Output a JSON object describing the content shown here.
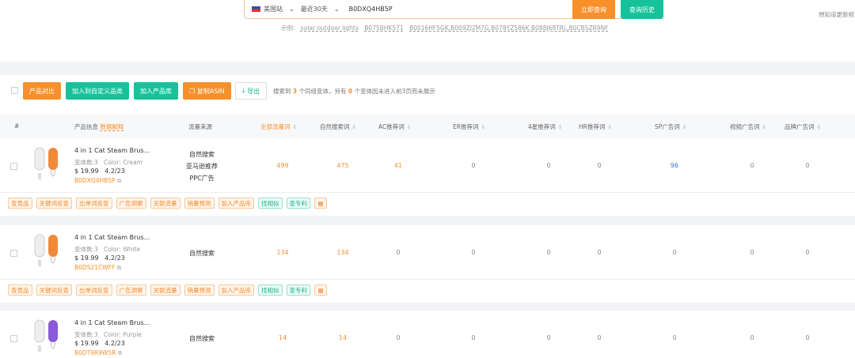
{
  "search": {
    "site": "美国站",
    "period": "最近30天",
    "query": "B0DXQ4HB5P",
    "search_button": "立即查询",
    "history_button": "查询历史"
  },
  "examples": {
    "label": "示例:",
    "items": [
      "solar outdoor lights",
      "B075BHK571",
      "B0016HF5GK,B009ZJ2M7G,B078YZ586K,B088J68TRL,B0CBSZR9NF"
    ]
  },
  "top_hint": "想知道更新频",
  "toolbar": {
    "compare": "产品对比",
    "add_custom": "加入到自定义品类",
    "add_library": "加入产品库",
    "copy_asin": "复制ASIN",
    "export": "导出",
    "summary_pre": "搜索到",
    "count1": "3",
    "summary_mid": "个同组变体，另有",
    "count2": "0",
    "summary_post": "个变体因未进入前3页而未展示"
  },
  "columns": {
    "index": "#",
    "product": "产品信息",
    "explain": "数据解释",
    "source": "流量来源",
    "all": "全部流量词",
    "organic": "自然搜索词",
    "ac": "AC推荐词",
    "er": "ER推荐词",
    "star4": "4星推荐词",
    "hr": "HR推荐词",
    "sp": "SP广告词",
    "video": "视频广告词",
    "brand": "品牌广告词"
  },
  "actions": [
    "查竞品",
    "关键词反查",
    "出单词反查",
    "广告洞察",
    "关联流量",
    "销量预测",
    "加入产品库",
    "找相似",
    "查专利"
  ],
  "rows": [
    {
      "title": "4 in 1 Cat Steam Brus...",
      "variants": "变体数:3",
      "color": "Color: Cream",
      "price": "$ 19.99",
      "rating": "4.2/23",
      "asin": "B0DXQ4HB5P",
      "sources": [
        "自然搜索",
        "亚马逊推荐",
        "PPC广告"
      ],
      "all": "499",
      "organic": "475",
      "ac": "41",
      "er": "0",
      "star4": "0",
      "hr": "0",
      "sp": "96",
      "video": "0",
      "brand": "0",
      "accent": "#f08a3a"
    },
    {
      "title": "4 in 1 Cat Steam Brus...",
      "variants": "变体数:3",
      "color": "Color: White",
      "price": "$ 19.99",
      "rating": "4.2/23",
      "asin": "B0DS21CWFF",
      "sources": [
        "自然搜索"
      ],
      "all": "134",
      "organic": "134",
      "ac": "0",
      "er": "0",
      "star4": "0",
      "hr": "0",
      "sp": "0",
      "video": "0",
      "brand": "0",
      "accent": "#f08a3a"
    },
    {
      "title": "4 in 1 Cat Steam Brus...",
      "variants": "变体数:3",
      "color": "Color: Purple",
      "price": "$ 19.99",
      "rating": "4.2/23",
      "asin": "B0DT9R9W5R",
      "sources": [
        "自然搜索"
      ],
      "all": "14",
      "organic": "14",
      "ac": "0",
      "er": "0",
      "star4": "0",
      "hr": "0",
      "sp": "0",
      "video": "0",
      "brand": "0",
      "accent": "#8a5ad8"
    }
  ]
}
